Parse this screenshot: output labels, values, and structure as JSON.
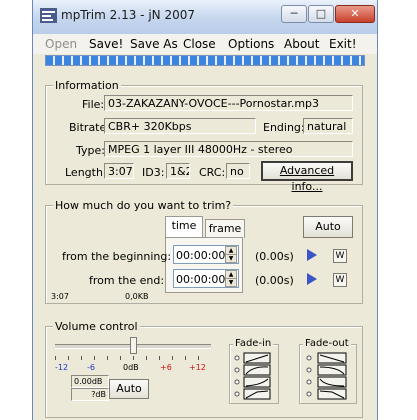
{
  "window": {
    "title": "mpTrim 2.13 - jN 2007"
  },
  "menu": [
    "Open",
    "Save!",
    "Save As",
    "Close",
    "Options",
    "About",
    "Exit!"
  ],
  "info": {
    "group_label": "Information",
    "file_label": "File:",
    "file": "03-ZAKAZANY-OVOCE---Pornostar.mp3",
    "bitrate_label": "Bitrate:",
    "bitrate": "CBR+ 320Kbps",
    "ending_label": "Ending:",
    "ending": "natural",
    "type_label": "Type:",
    "type": "MPEG 1 layer III 48000Hz - stereo",
    "length_label": "Length:",
    "length": "3:07",
    "id3_label": "ID3:",
    "id3": "1&2",
    "crc_label": "CRC:",
    "crc": "no",
    "advanced_button": "Advanced info..."
  },
  "trim": {
    "group_label": "How much do you want to trim?",
    "tabs": [
      "time",
      "frame"
    ],
    "auto_button": "Auto",
    "begin_label": "from the beginning:",
    "begin_value": "00:00:00",
    "begin_seconds": "(0.00s)",
    "end_label": "from the end:",
    "end_value": "00:00:00",
    "end_seconds": "(0.00s)",
    "w_label": "W",
    "duration": "3:07",
    "size": "0,0KB"
  },
  "volume": {
    "group_label": "Volume control",
    "scale": [
      "-12",
      "-6",
      "0dB",
      "+6",
      "+12"
    ],
    "readout_db": "0.00dB",
    "readout_q": "?dB",
    "auto_button": "Auto",
    "fadein_label": "Fade-in",
    "fadeout_label": "Fade-out",
    "level_fraction": 0.5
  },
  "colors": {
    "accent": "#3a56c8",
    "scale_negative": "#2233cc",
    "scale_positive": "#cc1111"
  }
}
